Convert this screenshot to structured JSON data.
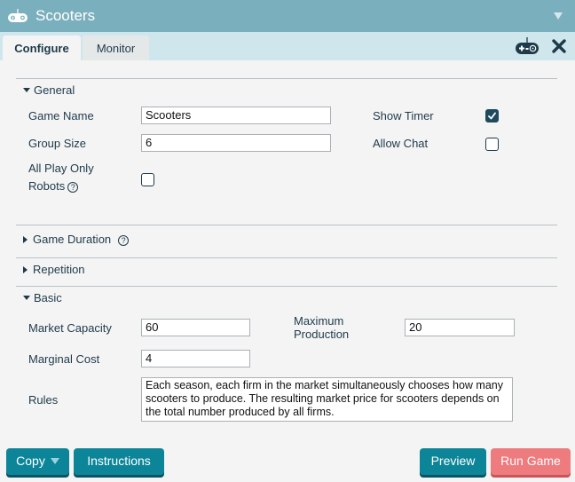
{
  "window": {
    "title": "Scooters",
    "app_icon": "gamepad-icon",
    "collapse_icon": "triangle-down-icon"
  },
  "tabs": [
    {
      "label": "Configure",
      "active": true
    },
    {
      "label": "Monitor",
      "active": false
    }
  ],
  "toolbar": {
    "game_icon": "gamepad-icon",
    "close_icon": "close-icon"
  },
  "sections": {
    "general": {
      "title": "General",
      "expanded": true,
      "game_name_label": "Game Name",
      "game_name_value": "Scooters",
      "group_size_label": "Group Size",
      "group_size_value": "6",
      "robots_label_line1": "All Play Only",
      "robots_label_line2": "Robots",
      "robots_help": "?",
      "robots_checked": false,
      "show_timer_label": "Show Timer",
      "show_timer_checked": true,
      "allow_chat_label": "Allow Chat",
      "allow_chat_checked": false
    },
    "game_duration": {
      "title": "Game Duration",
      "help": "?",
      "expanded": false
    },
    "repetition": {
      "title": "Repetition",
      "expanded": false
    },
    "basic": {
      "title": "Basic",
      "expanded": true,
      "market_capacity_label": "Market Capacity",
      "market_capacity_value": "60",
      "max_production_label_line1": "Maximum",
      "max_production_label_line2": "Production",
      "max_production_value": "20",
      "marginal_cost_label": "Marginal Cost",
      "marginal_cost_value": "4",
      "rules_label": "Rules",
      "rules_value": "Each season, each firm in the market simultaneously chooses how many scooters to produce. The resulting market price for scooters depends on the total number produced by all firms."
    }
  },
  "footer": {
    "copy_label": "Copy",
    "instructions_label": "Instructions",
    "preview_label": "Preview",
    "run_game_label": "Run Game"
  },
  "colors": {
    "titlebar": "#7ab0bd",
    "tabbar": "#cfe7ec",
    "primary_button": "#0d8599",
    "run_button": "#ee7b7e",
    "text": "#1e3a4a"
  }
}
